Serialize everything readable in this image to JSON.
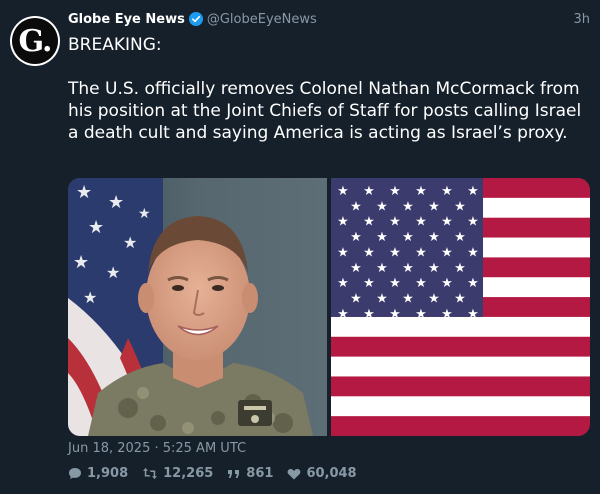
{
  "account": {
    "name": "Globe Eye News",
    "handle": "@GlobeEyeNews",
    "avatar_letter": "G.",
    "verified": true,
    "time_ago": "3h"
  },
  "tweet": {
    "line1": "BREAKING:",
    "body": "The U.S. officially removes Colonel Nathan McCormack from his position at the Joint Chiefs of Staff for posts calling Israel a death cult and saying America is acting as Israel’s proxy.",
    "timestamp": "Jun 18, 2025 · 5:25 AM UTC"
  },
  "stats": {
    "replies": "1,908",
    "retweets": "12,265",
    "quotes": "861",
    "likes": "60,048"
  },
  "colors": {
    "background": "#15202b",
    "secondary_text": "#8899a6",
    "verified_blue": "#1d9bf0"
  },
  "icons": [
    "verified-badge-icon",
    "reply-icon",
    "retweet-icon",
    "quote-icon",
    "like-icon"
  ]
}
